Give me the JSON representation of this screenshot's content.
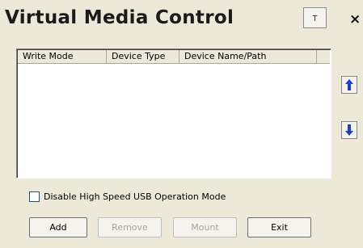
{
  "window": {
    "title": "Virtual Media Control",
    "pin_glyph": "⊤",
    "close_glyph": "×"
  },
  "list": {
    "columns": [
      "Write Mode",
      "Device Type",
      "Device Name/Path"
    ],
    "rows": []
  },
  "side_buttons": {
    "up_icon": "up-arrow-icon",
    "down_icon": "down-arrow-icon",
    "arrow_color": "#1b3fcc"
  },
  "options": {
    "disable_usb_label": "Disable High Speed USB Operation Mode",
    "disable_usb_checked": false
  },
  "buttons": {
    "add": "Add",
    "remove": "Remove",
    "mount": "Mount",
    "exit": "Exit"
  }
}
